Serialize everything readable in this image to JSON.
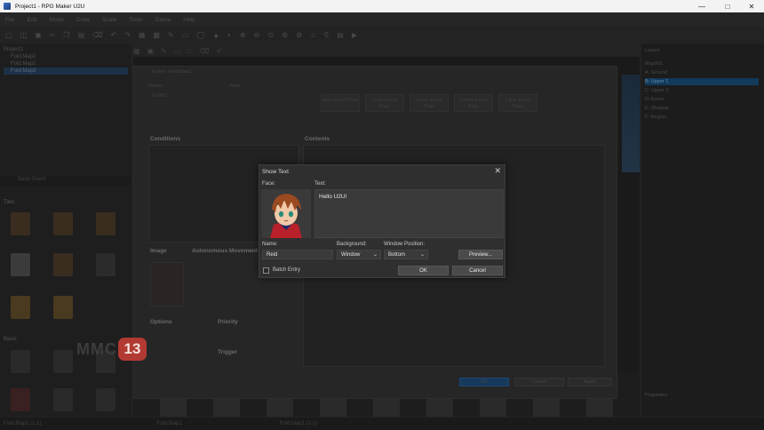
{
  "window": {
    "title": "Project1 - RPG Maker U2U"
  },
  "menubar": {
    "items": [
      "File",
      "Edit",
      "Mode",
      "Draw",
      "Scale",
      "Tools",
      "Game",
      "Help"
    ]
  },
  "map_tree": {
    "project": "Project1",
    "maps": [
      "Fold.Map1",
      "Fold.Map2",
      "Fold.Map3"
    ]
  },
  "left_panel": {
    "tileset_label": "Basic Event",
    "section_a": "Tiles",
    "section_b": "Basic"
  },
  "right_panel": {
    "header": "Layers",
    "group": "Map001",
    "layers": [
      "A: Ground",
      "B: Upper 1",
      "C: Upper 2",
      "D: Event",
      "E: Shadow",
      "F: Region"
    ],
    "footer": "Properties"
  },
  "status": {
    "left": "Fold.Map1 (1,1)",
    "mid1": "Fold.Map1",
    "mid2": "Fold.Map1 (1,1)"
  },
  "event_editor": {
    "title": "Event - Fold.Map1",
    "name_label": "Name:",
    "name_value": "EV001",
    "note_label": "Note:",
    "tabs": [
      "New Event Page",
      "Copy Event Page",
      "Paste Event Page",
      "Delete Event Page",
      "Clear Event Page"
    ],
    "conditions_title": "Conditions",
    "contents_title": "Contents",
    "image_title": "Image",
    "autonomous_title": "Autonomous Movement",
    "options_title": "Options",
    "priority_title": "Priority",
    "trigger_title": "Trigger",
    "ok": "OK",
    "cancel": "Cancel",
    "apply": "Apply"
  },
  "watermark": {
    "text": "MMC",
    "badge": "13"
  },
  "dialog": {
    "title": "Show Text",
    "face_label": "Face:",
    "text_label": "Text:",
    "text_value": "Hello U2U!",
    "name_label": "Name:",
    "name_value": "Reid",
    "background_label": "Background:",
    "background_value": "Window",
    "position_label": "Window Position:",
    "position_value": "Bottom",
    "preview_label": "Preview...",
    "batch_label": "Batch Entry",
    "ok_label": "OK",
    "cancel_label": "Cancel"
  }
}
